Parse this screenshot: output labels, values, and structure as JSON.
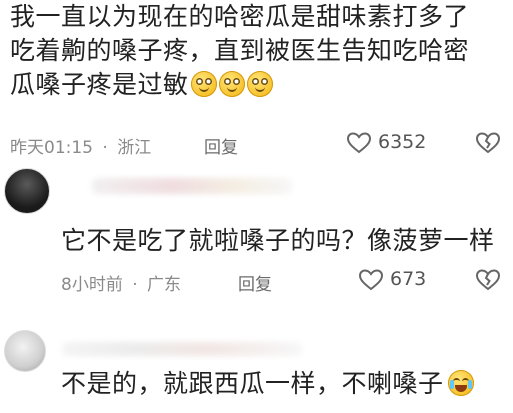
{
  "comments": [
    {
      "text_lines": [
        "我一直以为现在的哈密瓜是甜味素打多了",
        "吃着齁的嗓子疼，直到被医生告知吃哈密",
        "瓜嗓子疼是过敏"
      ],
      "emoji_count": 3,
      "time": "昨天01:15",
      "location": "浙江",
      "reply_label": "回复",
      "likes": "6352"
    },
    {
      "text": "它不是吃了就啦嗓子的吗？像菠萝一样",
      "time": "8小时前",
      "location": "广东",
      "reply_label": "回复",
      "likes": "673"
    },
    {
      "text": "不是的，就跟西瓜一样，不喇嗓子"
    }
  ],
  "separator": "·",
  "colors": {
    "text": "#222222",
    "meta": "#8a8a8a",
    "icon": "#666666"
  },
  "icons": [
    "heart-outline",
    "broken-heart",
    "grinning-emoji",
    "crying-laughing-emoji"
  ]
}
